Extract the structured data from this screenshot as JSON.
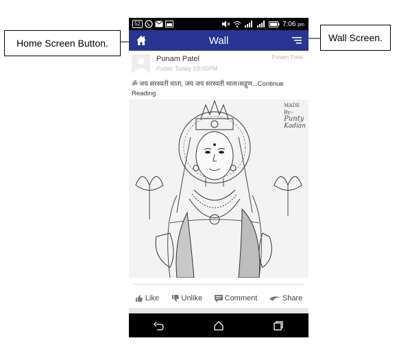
{
  "callouts": {
    "home": "Home Screen Button.",
    "wall": "Wall Screen."
  },
  "statusbar": {
    "notif_count": "52",
    "time": "7:06",
    "ampm": "pm"
  },
  "appbar": {
    "title": "Wall"
  },
  "post": {
    "author": "Punam Patel",
    "meta": "Public Today 19:05PM",
    "author_right": "Punam Patel",
    "text": "ॐ जय सरस्वती माता, जय जय सरस्वती माता।सद्गुण...Continue Reading",
    "image_signature_1": "MADE",
    "image_signature_2": "By:-",
    "image_signature_3": "Punty",
    "image_signature_4": "Kadian"
  },
  "actions": {
    "like": "Like",
    "unlike": "Unlike",
    "comment": "Comment",
    "share": "Share"
  },
  "colors": {
    "appbar": "#283593",
    "status": "#000000"
  }
}
